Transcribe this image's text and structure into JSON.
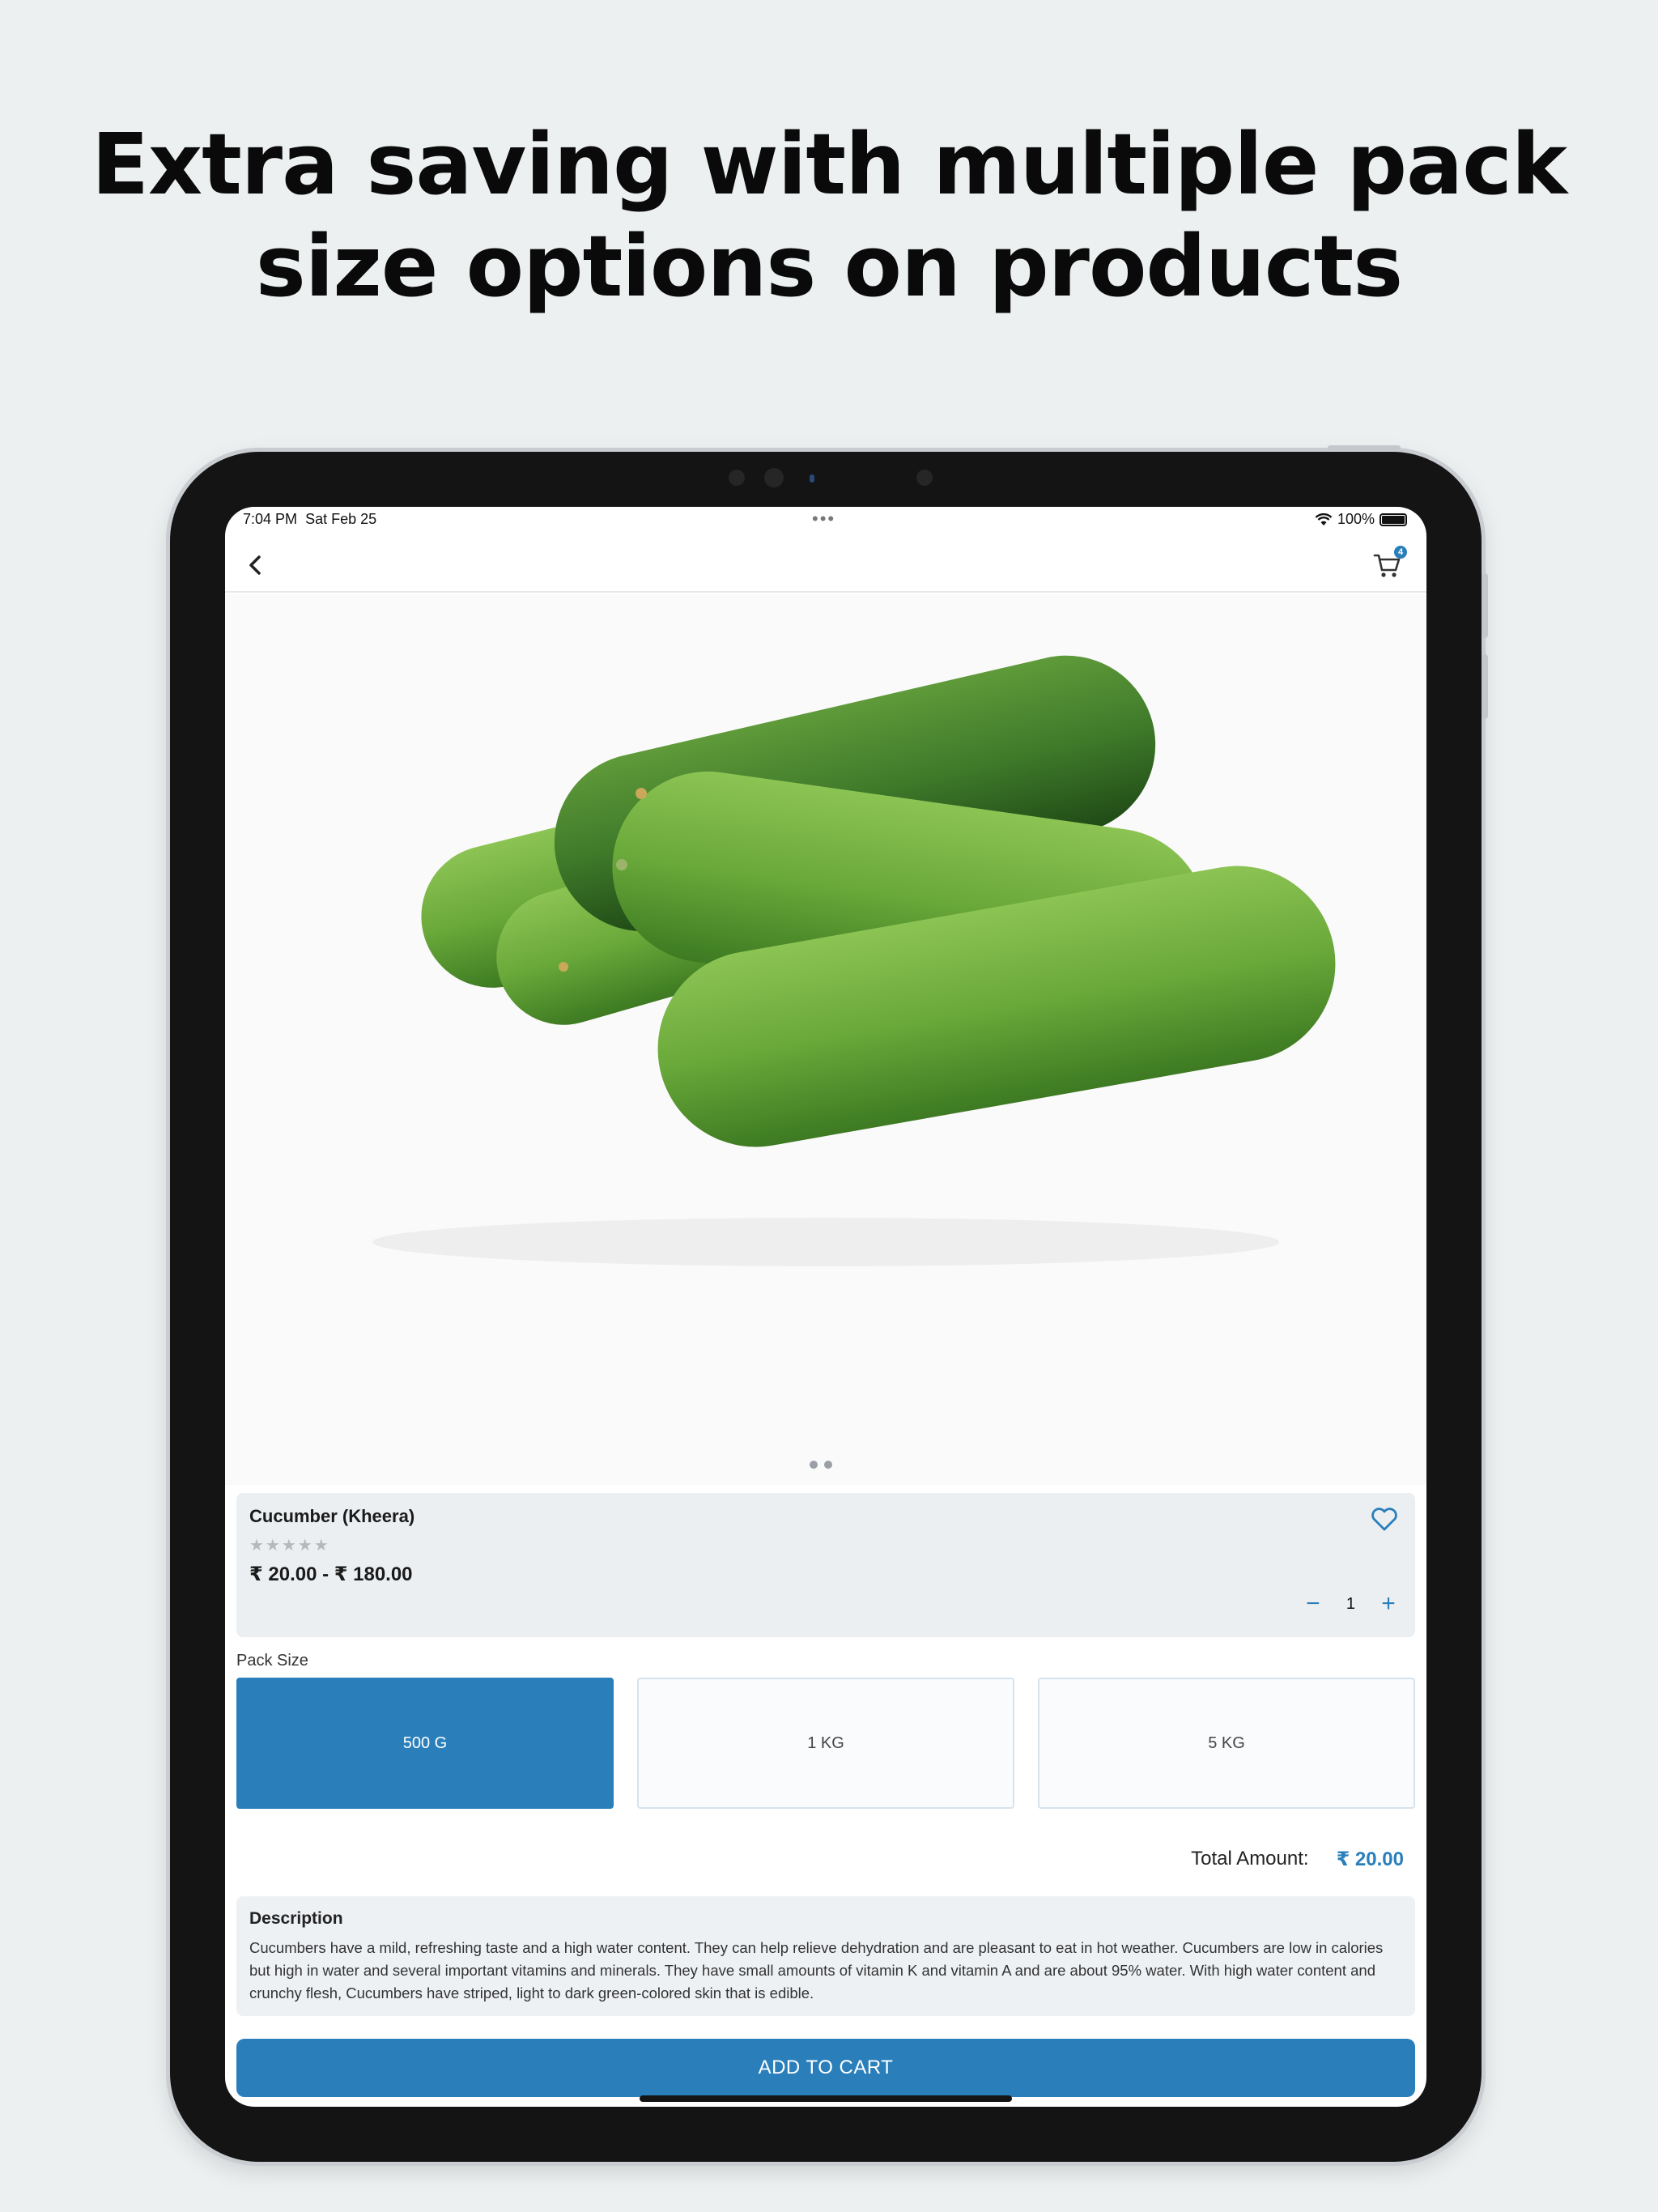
{
  "headline": {
    "line1": "Extra saving with multiple pack",
    "line2": "size options on products"
  },
  "status_bar": {
    "time": "7:04 PM",
    "date": "Sat Feb 25",
    "dots": "•••",
    "battery": "100%"
  },
  "nav": {
    "back_icon": "chevron-left-icon",
    "cart_icon": "cart-icon",
    "cart_count": "4"
  },
  "product": {
    "name": "Cucumber (Kheera)",
    "stars": "★★★★★",
    "price_range": "₹ 20.00 - ₹ 180.00",
    "quantity": "1",
    "qty_minus": "−",
    "qty_plus": "+"
  },
  "pack_size": {
    "label": "Pack Size",
    "options": [
      "500 G",
      "1 KG",
      "5 KG"
    ],
    "selected": "500 G"
  },
  "total": {
    "label": "Total Amount:",
    "value": "₹ 20.00"
  },
  "description": {
    "title": "Description",
    "text": "Cucumbers have a mild, refreshing taste and a high water content. They can help relieve dehydration and are pleasant to eat in hot weather. Cucumbers are low in calories but high in water and several important vitamins and minerals. They have small amounts of vitamin K and vitamin A and are about 95% water. With high water content and crunchy flesh, Cucumbers have striped, light to dark green-colored skin that is edible."
  },
  "actions": {
    "add_to_cart": "ADD TO CART"
  },
  "colors": {
    "accent": "#2a7fbb",
    "background": "#ecf0f1",
    "device": "#141414"
  }
}
